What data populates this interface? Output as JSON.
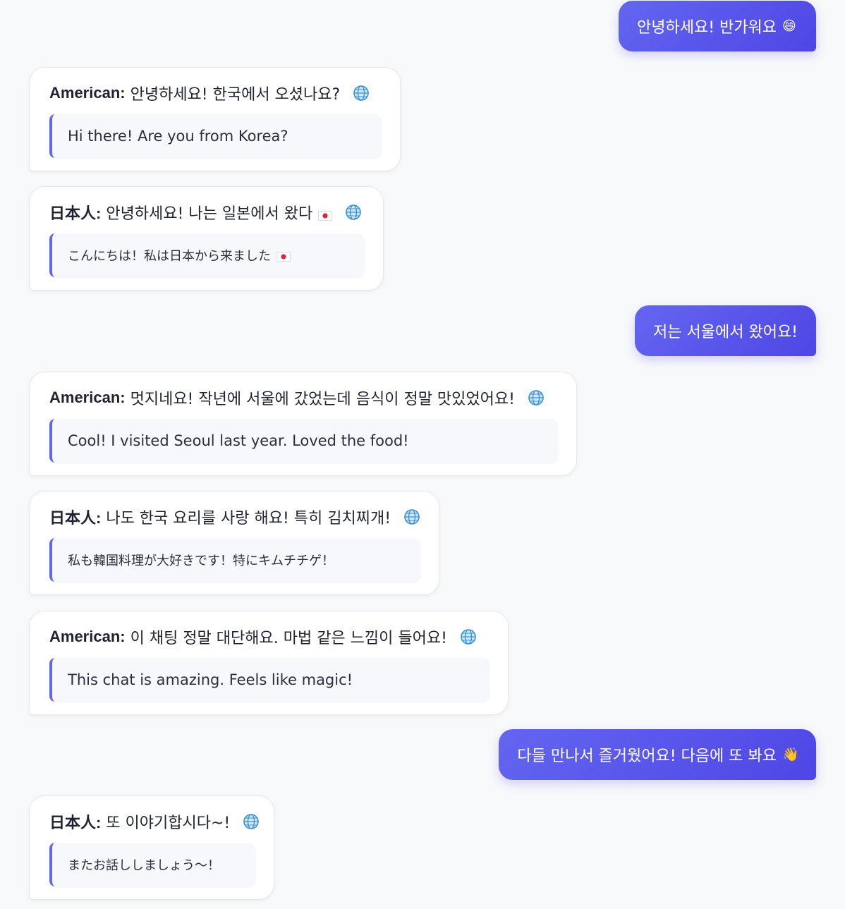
{
  "conversation": {
    "messages": [
      {
        "type": "outgoing",
        "text": "안녕하세요! 반가워요",
        "emoji": "😄"
      },
      {
        "type": "incoming",
        "speaker": "American:",
        "original": "안녕하세요! 한국에서 오셨나요?",
        "translation": "Hi there! Are you from Korea?"
      },
      {
        "type": "incoming",
        "speaker": "日本人:",
        "original": "안녕하세요! 나는 일본에서 왔다",
        "translation": "こんにちは！私は日本から来ました",
        "flag": "japan-flag"
      },
      {
        "type": "outgoing",
        "text": "저는 서울에서 왔어요!"
      },
      {
        "type": "incoming",
        "speaker": "American:",
        "original": "멋지네요! 작년에 서울에 갔었는데 음식이 정말 맛있었어요!",
        "translation": "Cool! I visited Seoul last year. Loved the food!"
      },
      {
        "type": "incoming",
        "speaker": "日本人:",
        "original": "나도 한국 요리를 사랑 해요! 특히 김치찌개!",
        "translation": "私も韓国料理が大好きです！特にキムチチゲ！"
      },
      {
        "type": "incoming",
        "speaker": "American:",
        "original": "이 채팅 정말 대단해요. 마법 같은 느낌이 들어요!",
        "translation": "This chat is amazing. Feels like magic!"
      },
      {
        "type": "outgoing",
        "text": "다들 만나서 즐거웠어요! 다음에 또 봐요",
        "emoji": "👋"
      },
      {
        "type": "incoming",
        "speaker": "日本人:",
        "original": "또 이야기합시다~!",
        "translation": "またお話ししましょう～！"
      }
    ]
  },
  "icons": {
    "translate": "globe-icon",
    "flag": "japan-flag"
  },
  "colors": {
    "background": "#f8f9fb",
    "outgoing_bubble": "#5b5ef0",
    "outgoing_text": "#ffffff",
    "incoming_bubble": "#ffffff",
    "translation_box": "#f7f8fb",
    "translation_accent": "#6366f1",
    "text": "#1f2330"
  }
}
